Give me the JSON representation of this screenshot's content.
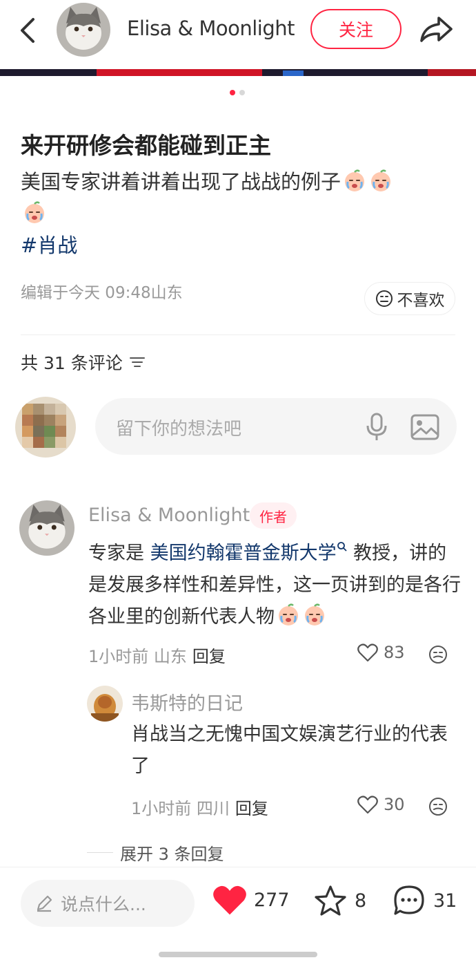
{
  "header": {
    "author_name": "Elisa & Moonlight",
    "follow_label": "关注"
  },
  "post": {
    "title": "来开研修会都能碰到正主",
    "body": "美国专家讲着讲着出现了战战的例子",
    "hashtag": "#肖战",
    "edited": "编辑于今天 09:48山东",
    "dislike_label": "不喜欢",
    "image_count": 2,
    "image_index": 1
  },
  "comments_section": {
    "count_label": "共 31 条评论",
    "input_placeholder": "留下你的想法吧"
  },
  "comments": [
    {
      "name": "Elisa & Moonlight",
      "badge": "作者",
      "text_before": "专家是 ",
      "link": "美国约翰霍普金斯大学",
      "text_after": " 教授，讲的是发展多样性和差异性，这一页讲到的是各行各业里的创新代表人物",
      "time_location": "1小时前 山东",
      "reply_label": "回复",
      "likes": "83",
      "replies": [
        {
          "name": "韦斯特的日记",
          "text": "肖战当之无愧中国文娱演艺行业的代表了",
          "time_location": "1小时前 四川",
          "reply_label": "回复",
          "likes": "30"
        }
      ],
      "expand_label": "展开 3 条回复"
    }
  ],
  "bottom_bar": {
    "input_placeholder": "说点什么...",
    "likes": "277",
    "favorites": "8",
    "comments": "31"
  },
  "colors": {
    "accent": "#ff2442",
    "link": "#13386c"
  }
}
